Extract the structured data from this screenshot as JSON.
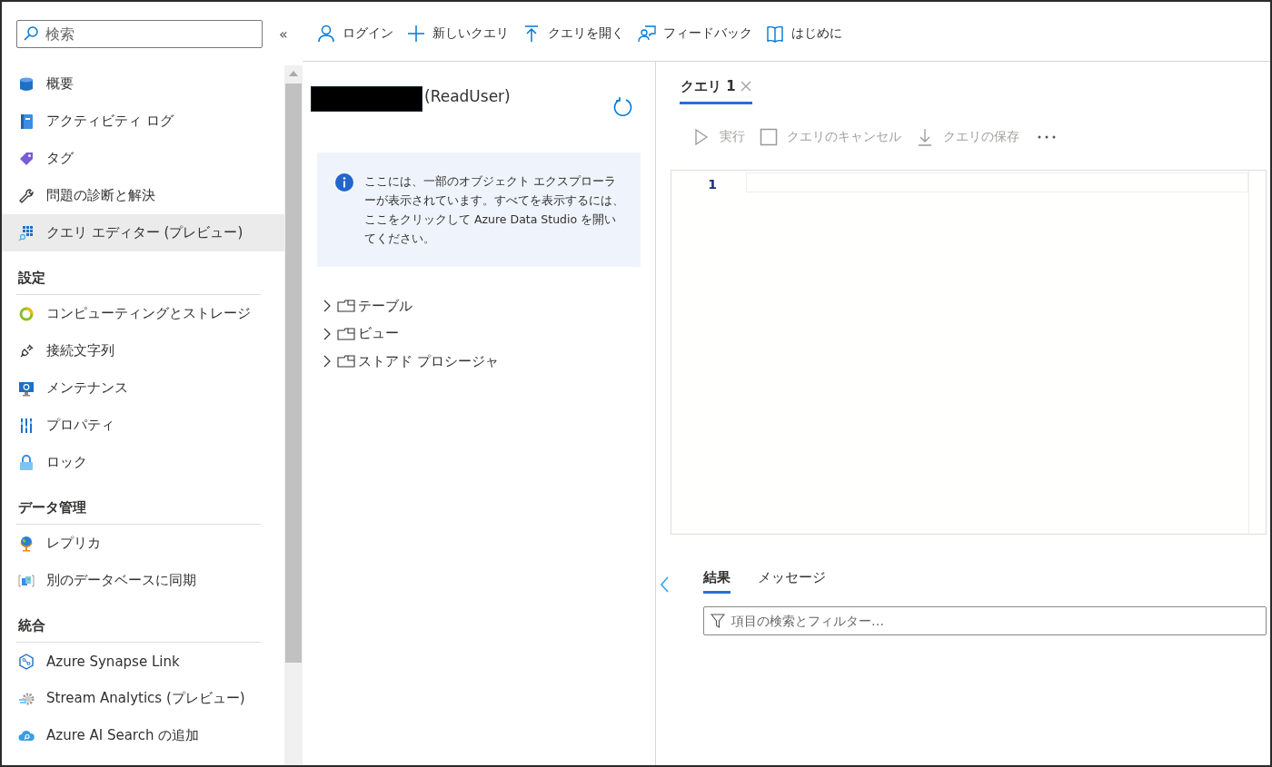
{
  "sidebar": {
    "search": {
      "placeholder": "検索"
    },
    "collapse": "«",
    "items": [
      {
        "kind": "item",
        "label": "概要",
        "selected": false
      },
      {
        "kind": "item",
        "label": "アクティビティ ログ",
        "selected": false
      },
      {
        "kind": "item",
        "label": "タグ",
        "selected": false
      },
      {
        "kind": "item",
        "label": "問題の診断と解決",
        "selected": false
      },
      {
        "kind": "item",
        "label": "クエリ エディター (プレビュー)",
        "selected": true
      },
      {
        "kind": "heading",
        "label": "設定"
      },
      {
        "kind": "item",
        "label": "コンピューティングとストレージ",
        "selected": false
      },
      {
        "kind": "item",
        "label": "接続文字列",
        "selected": false
      },
      {
        "kind": "item",
        "label": "メンテナンス",
        "selected": false
      },
      {
        "kind": "item",
        "label": "プロパティ",
        "selected": false
      },
      {
        "kind": "item",
        "label": "ロック",
        "selected": false
      },
      {
        "kind": "heading",
        "label": "データ管理"
      },
      {
        "kind": "item",
        "label": "レプリカ",
        "selected": false
      },
      {
        "kind": "item",
        "label": "別のデータベースに同期",
        "selected": false
      },
      {
        "kind": "heading",
        "label": "統合"
      },
      {
        "kind": "item",
        "label": "Azure Synapse Link",
        "selected": false
      },
      {
        "kind": "item",
        "label": "Stream Analytics (プレビュー)",
        "selected": false
      },
      {
        "kind": "item",
        "label": "Azure AI Search の追加",
        "selected": false
      }
    ]
  },
  "toolbar": [
    "ログイン",
    "新しいクエリ",
    "クエリを開く",
    "フィードバック",
    "はじめに"
  ],
  "explorer": {
    "user": "(ReadUser)",
    "info": "ここには、一部のオブジェクト エクスプローラーが表示されています。すべてを表示するには、ここをクリックして Azure Data Studio を開いてください。",
    "tree": [
      {
        "label": "テーブル",
        "expanded": false
      },
      {
        "label": "ビュー",
        "expanded": false
      },
      {
        "label": "ストアド プロシージャ",
        "expanded": false
      }
    ]
  },
  "editor": {
    "tabs": [
      {
        "label": "クエリ 1",
        "selected": true
      }
    ],
    "actions": [
      {
        "label": "実行",
        "disabled": true
      },
      {
        "label": "クエリのキャンセル",
        "disabled": true
      },
      {
        "label": "クエリの保存",
        "disabled": true
      }
    ],
    "line_numbers": [
      "1"
    ]
  },
  "results": {
    "tabs": [
      {
        "label": "結果",
        "selected": true
      },
      {
        "label": "メッセージ",
        "selected": false
      }
    ],
    "filter": {
      "placeholder": "項目の検索とフィルター…"
    }
  }
}
